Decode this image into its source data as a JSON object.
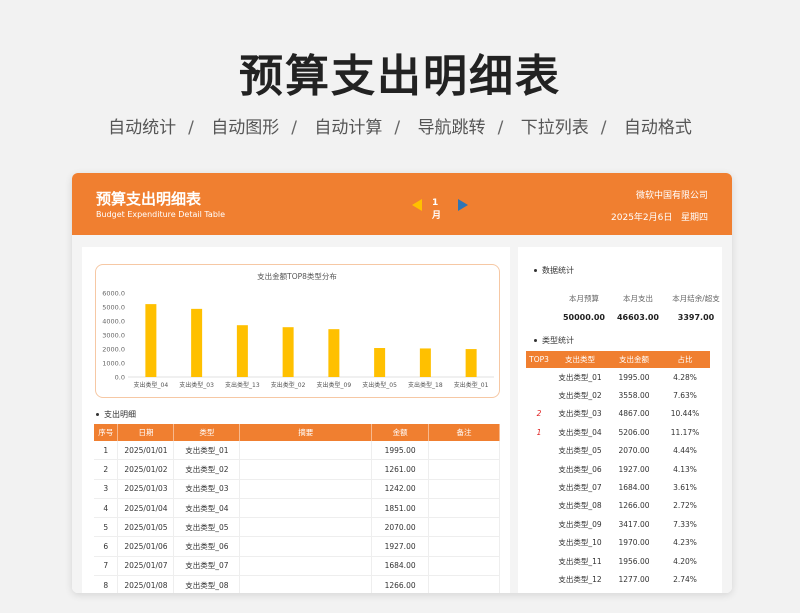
{
  "hero": {
    "title": "预算支出明细表",
    "features": [
      "自动统计",
      "自动图形",
      "自动计算",
      "导航跳转",
      "下拉列表",
      "自动格式"
    ],
    "separator": "/"
  },
  "header": {
    "title": "预算支出明细表",
    "subtitle": "Budget Expenditure Detail Table",
    "month": "1月",
    "company": "微软中国有限公司",
    "date": "2025年2月6日",
    "weekday": "星期四"
  },
  "colors": {
    "accent": "#f07f30",
    "bar": "#ffc000",
    "nav_left": "#ffc000",
    "nav_right": "#2f75b5",
    "rank": "#e02020"
  },
  "chart_data": {
    "type": "bar",
    "title": "支出金额TOP8类型分布",
    "categories": [
      "支出类型_04",
      "支出类型_03",
      "支出类型_13",
      "支出类型_02",
      "支出类型_09",
      "支出类型_05",
      "支出类型_18",
      "支出类型_01"
    ],
    "values": [
      5206,
      4867,
      3700,
      3558,
      3417,
      2070,
      2040,
      1995
    ],
    "ylim": [
      0,
      6000
    ],
    "yticks": [
      "0.0",
      "1000.0",
      "2000.0",
      "3000.0",
      "4000.0",
      "5000.0",
      "6000.0"
    ],
    "xlabel": "",
    "ylabel": ""
  },
  "detail": {
    "section_label": "支出明细",
    "columns": [
      "序号",
      "日期",
      "类型",
      "摘要",
      "金额",
      "备注"
    ],
    "rows": [
      [
        "1",
        "2025/01/01",
        "支出类型_01",
        "",
        "1995.00",
        ""
      ],
      [
        "2",
        "2025/01/02",
        "支出类型_02",
        "",
        "1261.00",
        ""
      ],
      [
        "3",
        "2025/01/03",
        "支出类型_03",
        "",
        "1242.00",
        ""
      ],
      [
        "4",
        "2025/01/04",
        "支出类型_04",
        "",
        "1851.00",
        ""
      ],
      [
        "5",
        "2025/01/05",
        "支出类型_05",
        "",
        "2070.00",
        ""
      ],
      [
        "6",
        "2025/01/06",
        "支出类型_06",
        "",
        "1927.00",
        ""
      ],
      [
        "7",
        "2025/01/07",
        "支出类型_07",
        "",
        "1684.00",
        ""
      ],
      [
        "8",
        "2025/01/08",
        "支出类型_08",
        "",
        "1266.00",
        ""
      ]
    ]
  },
  "stats": {
    "section_label": "数据统计",
    "labels": [
      "本月预算",
      "本月支出",
      "本月结余/超支"
    ],
    "values": [
      "50000.00",
      "46603.00",
      "3397.00"
    ]
  },
  "types": {
    "section_label": "类型统计",
    "columns": [
      "TOP3",
      "支出类型",
      "支出金额",
      "占比"
    ],
    "rows": [
      [
        "",
        "支出类型_01",
        "1995.00",
        "4.28%"
      ],
      [
        "",
        "支出类型_02",
        "3558.00",
        "7.63%"
      ],
      [
        "2",
        "支出类型_03",
        "4867.00",
        "10.44%"
      ],
      [
        "1",
        "支出类型_04",
        "5206.00",
        "11.17%"
      ],
      [
        "",
        "支出类型_05",
        "2070.00",
        "4.44%"
      ],
      [
        "",
        "支出类型_06",
        "1927.00",
        "4.13%"
      ],
      [
        "",
        "支出类型_07",
        "1684.00",
        "3.61%"
      ],
      [
        "",
        "支出类型_08",
        "1266.00",
        "2.72%"
      ],
      [
        "",
        "支出类型_09",
        "3417.00",
        "7.33%"
      ],
      [
        "",
        "支出类型_10",
        "1970.00",
        "4.23%"
      ],
      [
        "",
        "支出类型_11",
        "1956.00",
        "4.20%"
      ],
      [
        "",
        "支出类型_12",
        "1277.00",
        "2.74%"
      ]
    ]
  }
}
